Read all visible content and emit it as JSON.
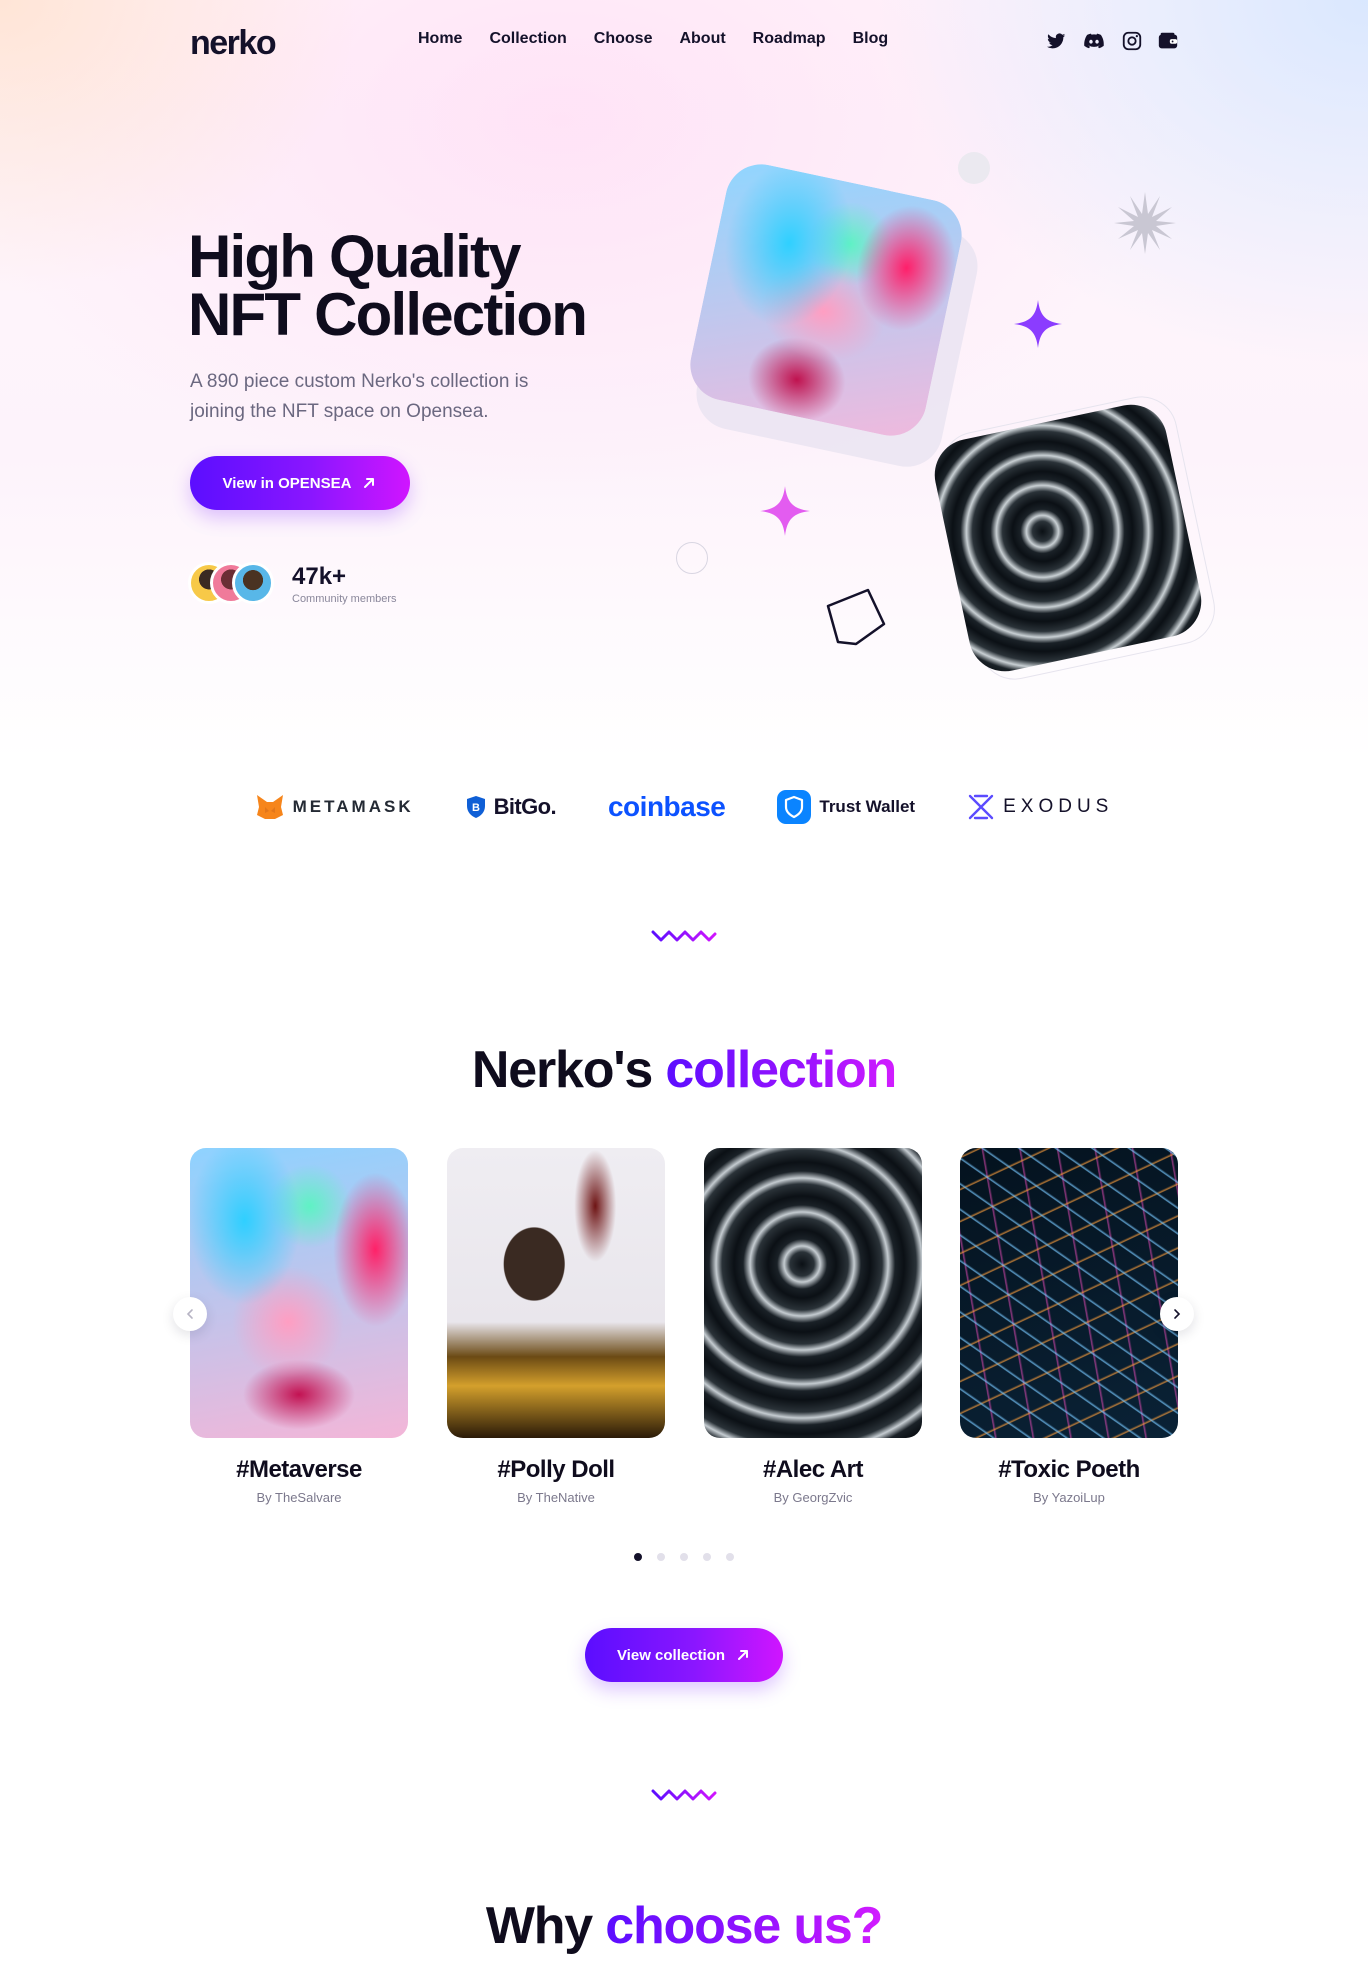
{
  "brand": {
    "logo": "nerko"
  },
  "nav": {
    "items": [
      "Home",
      "Collection",
      "Choose",
      "About",
      "Roadmap",
      "Blog"
    ]
  },
  "social": [
    "twitter-icon",
    "discord-icon",
    "instagram-icon",
    "wallet-icon"
  ],
  "hero": {
    "title_line1": "High Quality",
    "title_line2": "NFT Collection",
    "subtitle": "A 890 piece custom Nerko's collection is joining the NFT space on Opensea.",
    "cta_label": "View in OPENSEA",
    "members_count": "47k+",
    "members_label": "Community members"
  },
  "partners": [
    "METAMASK",
    "BitGo.",
    "coinbase",
    "Trust Wallet",
    "EXODUS"
  ],
  "collection": {
    "title_plain": "Nerko's",
    "title_accent": "collection",
    "cards": [
      {
        "title": "#Metaverse",
        "author": "By TheSalvare"
      },
      {
        "title": "#Polly Doll",
        "author": "By TheNative"
      },
      {
        "title": "#Alec Art",
        "author": "By GeorgZvic"
      },
      {
        "title": "#Toxic Poeth",
        "author": "By YazoiLup"
      }
    ],
    "page_count": 5,
    "active_page": 1,
    "cta_label": "View collection"
  },
  "choose": {
    "title_plain": "Why",
    "title_accent": "choose us?"
  },
  "colors": {
    "accent_start": "#5b0eff",
    "accent_end": "#d015ff",
    "text": "#0f0c1d"
  }
}
